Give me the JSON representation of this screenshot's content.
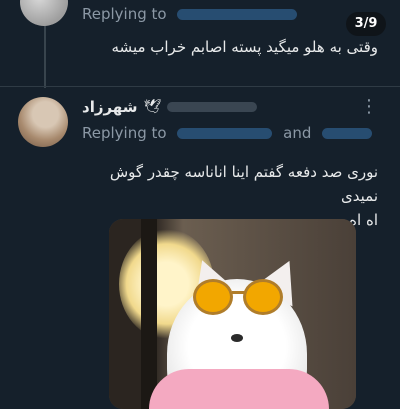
{
  "top_tweet": {
    "replying_label": "Replying to",
    "text": "وقتی به هلو میگید پسته اصابم خراب میشه"
  },
  "counter": "3/9",
  "reply_tweet": {
    "name": "شهرزاد",
    "name_icon": "dove-icon",
    "replying_label": "Replying to",
    "and_label": "and",
    "text_line1": "نوری صد دفعه گفتم اینا انانا‌سه چقدر گوش نمیدی",
    "text_line2": "اه اه"
  },
  "colors": {
    "background": "#15202b",
    "link": "#1d9bf0",
    "muted": "#8b98a5"
  }
}
